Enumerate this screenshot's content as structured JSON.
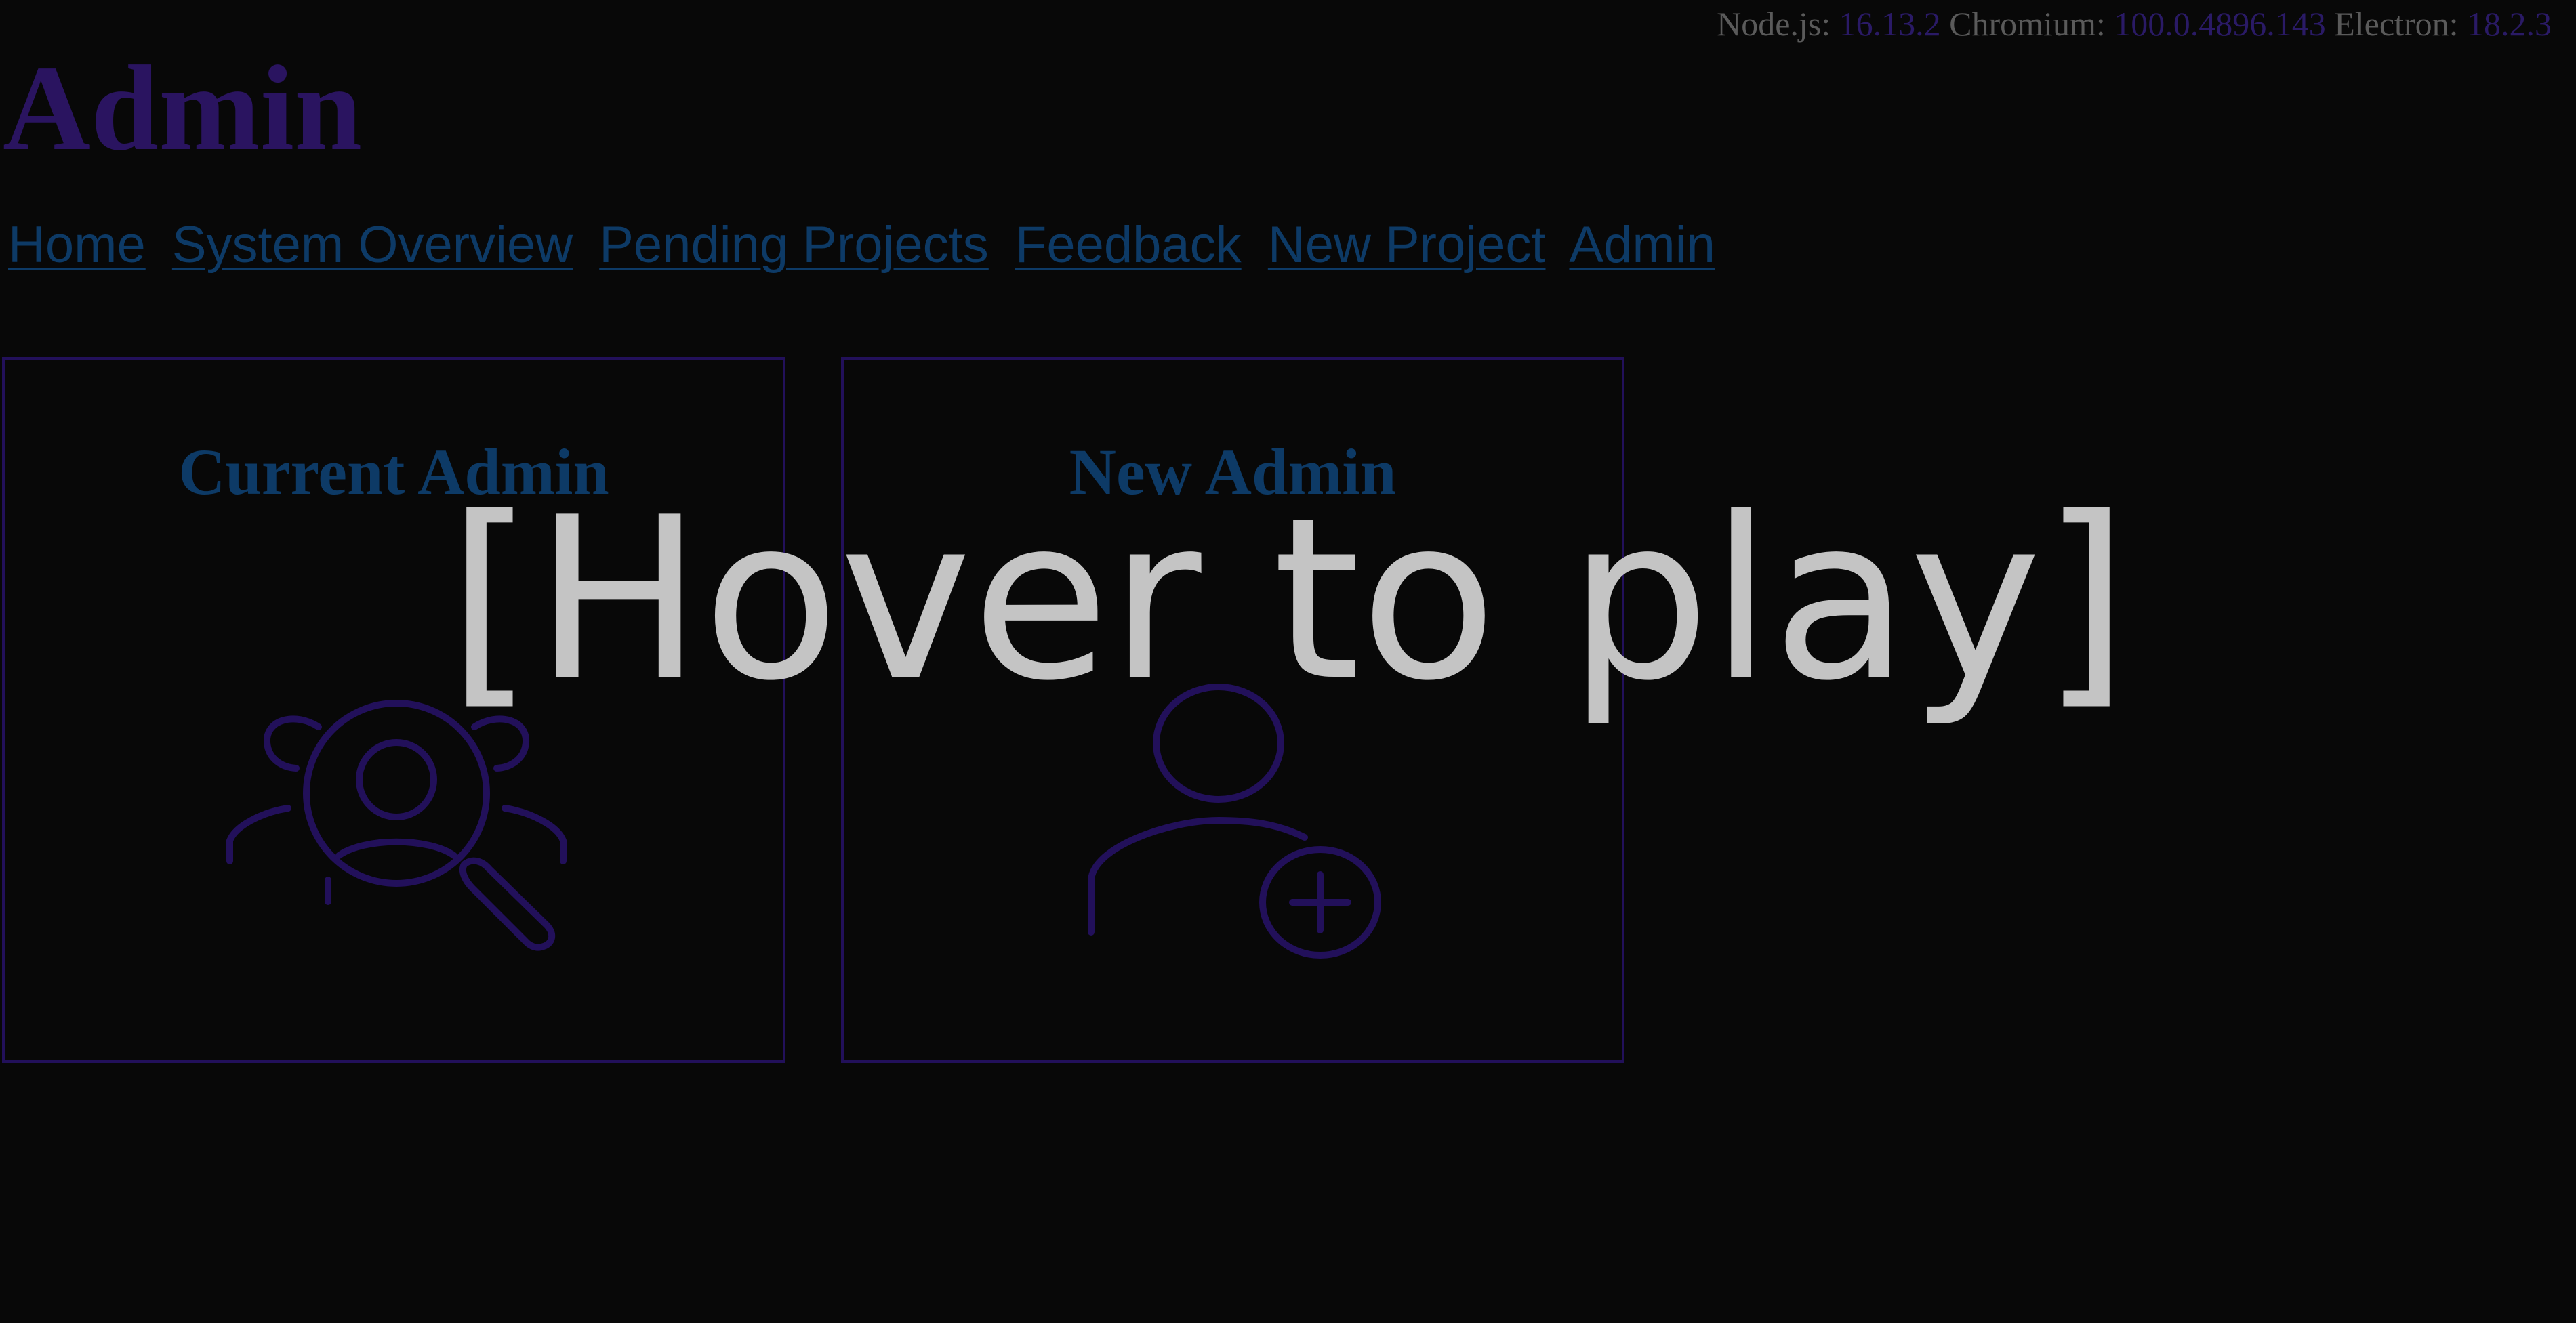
{
  "versions": {
    "node_label": "Node.js:",
    "node_value": "16.13.2",
    "chromium_label": "Chromium:",
    "chromium_value": "100.0.4896.143",
    "electron_label": "Electron:",
    "electron_value": "18.2.3"
  },
  "page": {
    "title": "Admin"
  },
  "nav": {
    "items": [
      {
        "label": "Home"
      },
      {
        "label": "System Overview"
      },
      {
        "label": "Pending Projects"
      },
      {
        "label": "Feedback"
      },
      {
        "label": "New Project"
      },
      {
        "label": "Admin"
      }
    ]
  },
  "cards": [
    {
      "title": "Current Admin",
      "icon": "user-search-icon"
    },
    {
      "title": "New Admin",
      "icon": "add-user-icon"
    }
  ],
  "overlay": {
    "text": "[Hover to play]"
  },
  "colors": {
    "background": "#080808",
    "accent_purple": "#2a1460",
    "link_blue": "#0d3a66",
    "overlay_text": "#c4c4c4"
  }
}
